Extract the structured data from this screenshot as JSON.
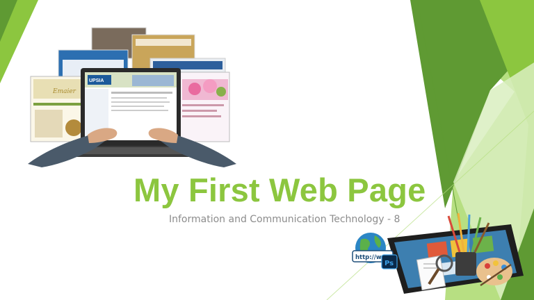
{
  "slide": {
    "title": "My First Web Page",
    "subtitle": "Information and Communication Technology - 8"
  },
  "colors": {
    "title": "#8cc63f",
    "subtitle": "#8c8c8c",
    "green_dark": "#5f9a33",
    "green_mid": "#8cc63f",
    "green_light": "#b7df82",
    "green_pale": "#d9efbf"
  },
  "illustrations": {
    "left": "laptop-with-web-pages-illustration",
    "right": "tablet-with-design-tools-illustration"
  },
  "illustration_text": {
    "laptop_site": "UPSIA",
    "url_banner": "http://www",
    "ps_icon": "Ps"
  }
}
